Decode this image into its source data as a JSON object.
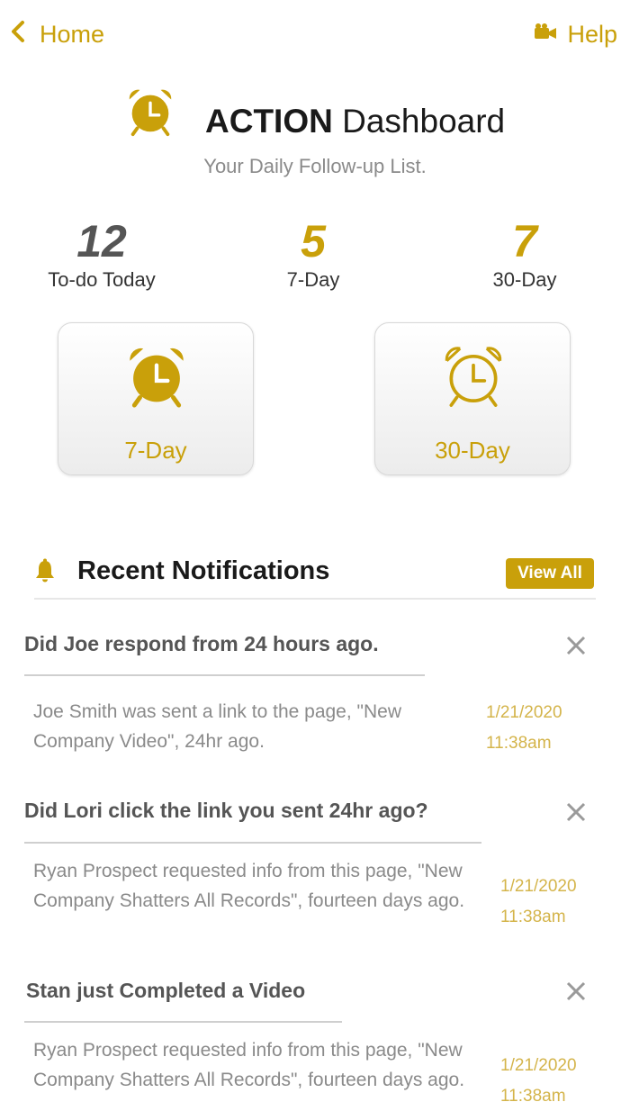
{
  "nav": {
    "home_label": "Home",
    "help_label": "Help"
  },
  "header": {
    "title_bold": "ACTION",
    "title_rest": "Dashboard",
    "subtitle": "Your Daily Follow-up List."
  },
  "stats": [
    {
      "number": "12",
      "label": "To-do Today"
    },
    {
      "number": "5",
      "label": "7-Day"
    },
    {
      "number": "7",
      "label": "30-Day"
    }
  ],
  "buttons": [
    {
      "label": "7-Day",
      "icon": "alarm-clock-filled-icon"
    },
    {
      "label": "30-Day",
      "icon": "alarm-clock-outline-icon"
    }
  ],
  "notifications": {
    "title": "Recent Notifications",
    "view_all_label": "View All",
    "items": [
      {
        "title": "Did Joe respond from 24 hours ago.",
        "body": "Joe Smith was sent a link to the page, \"New Company Video\", 24hr ago.",
        "date": "1/21/2020",
        "time": "11:38am"
      },
      {
        "title": "Did Lori click the link you sent 24hr ago?",
        "body": "Ryan Prospect requested info from this page, \"New Company Shatters All Records\", fourteen days ago.",
        "date": "1/21/2020",
        "time": "11:38am"
      },
      {
        "title": "Stan just Completed a Video",
        "body": "Ryan Prospect requested info from this page, \"New Company Shatters All Records\", fourteen days ago.",
        "date": "1/21/2020",
        "time": "11:38am"
      }
    ]
  },
  "colors": {
    "accent": "#c9a00a",
    "muted_text": "#8a8a8a",
    "date_text": "#d4b44a"
  }
}
